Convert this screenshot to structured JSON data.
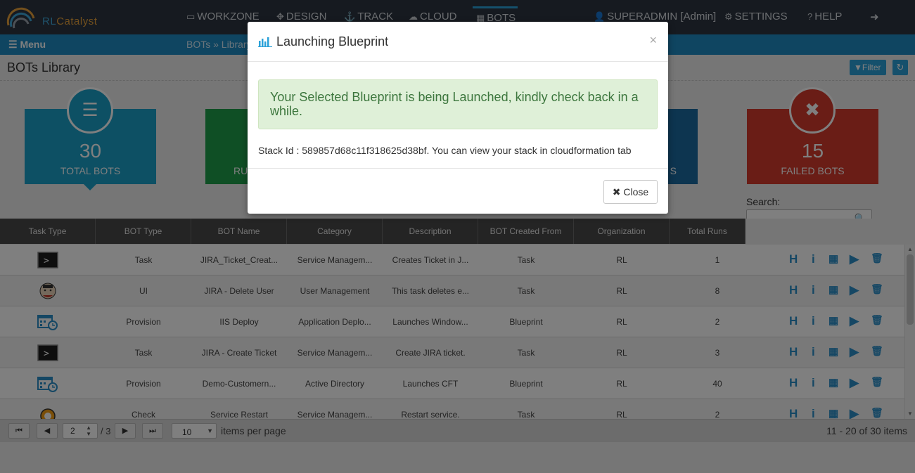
{
  "app": {
    "logo_left": "RL",
    "logo_right": "Catalyst"
  },
  "nav": {
    "items": [
      {
        "label": "WORKZONE",
        "icon": "workzone-icon"
      },
      {
        "label": "DESIGN",
        "icon": "design-icon"
      },
      {
        "label": "TRACK",
        "icon": "anchor-icon"
      },
      {
        "label": "CLOUD",
        "icon": "cloud-icon"
      },
      {
        "label": "BOTS",
        "icon": "bots-icon"
      }
    ],
    "user": "SUPERADMIN [Admin]",
    "settings": "SETTINGS",
    "help": "HELP"
  },
  "menubar": {
    "menu_label": "Menu",
    "breadcrumb": "BOTs » Library"
  },
  "page": {
    "title": "BOTs Library",
    "filter_label": "Filter"
  },
  "cards": [
    {
      "count": "30",
      "label": "TOTAL BOTS",
      "color": "#1aa0c8"
    },
    {
      "count": "",
      "label": "RU",
      "color": "#1f9e4a"
    },
    {
      "count": "",
      "label": "S",
      "color": "#1a6aa0"
    },
    {
      "count": "15",
      "label": "FAILED BOTS",
      "color": "#d43a2c"
    }
  ],
  "search": {
    "label": "Search:",
    "value": ""
  },
  "table": {
    "headers": [
      "Task Type",
      "BOT Type",
      "BOT Name",
      "Category",
      "Description",
      "BOT Created From",
      "Organization",
      "Total Runs"
    ],
    "rows": [
      {
        "task_icon": "terminal-icon",
        "bot_type": "Task",
        "name": "JIRA_Ticket_Creat...",
        "category": "Service Managem...",
        "description": "Creates Ticket in J...",
        "created_from": "Task",
        "org": "RL",
        "runs": "1"
      },
      {
        "task_icon": "jenkins-icon",
        "bot_type": "UI",
        "name": "JIRA - Delete User",
        "category": "User Management",
        "description": "This task deletes e...",
        "created_from": "Task",
        "org": "RL",
        "runs": "8"
      },
      {
        "task_icon": "calendar-clock-icon",
        "bot_type": "Provision",
        "name": "IIS Deploy",
        "category": "Application Deplo...",
        "description": "Launches Window...",
        "created_from": "Blueprint",
        "org": "RL",
        "runs": "2"
      },
      {
        "task_icon": "terminal-icon",
        "bot_type": "Task",
        "name": "JIRA - Create Ticket",
        "category": "Service Managem...",
        "description": "Create JIRA ticket.",
        "created_from": "Task",
        "org": "RL",
        "runs": "3"
      },
      {
        "task_icon": "calendar-clock-icon",
        "bot_type": "Provision",
        "name": "Demo-Customern...",
        "category": "Active Directory",
        "description": "Launches CFT",
        "created_from": "Blueprint",
        "org": "RL",
        "runs": "40"
      },
      {
        "task_icon": "chef-icon",
        "bot_type": "Check",
        "name": "Service Restart",
        "category": "Service Managem...",
        "description": "Restart service.",
        "created_from": "Task",
        "org": "RL",
        "runs": "2"
      }
    ]
  },
  "pager": {
    "page": "2",
    "of_pages": "/ 3",
    "page_size": "10",
    "per_page_label": "items per page",
    "info": "11 - 20 of 30 items"
  },
  "modal": {
    "title": "Launching Blueprint",
    "alert": "Your Selected Blueprint is being Launched, kindly check back in a while.",
    "stack_line": "Stack Id : 589857d68c11f318625d38bf. You can view your stack in cloudformation tab",
    "close_label": "Close",
    "close_x": "×"
  }
}
